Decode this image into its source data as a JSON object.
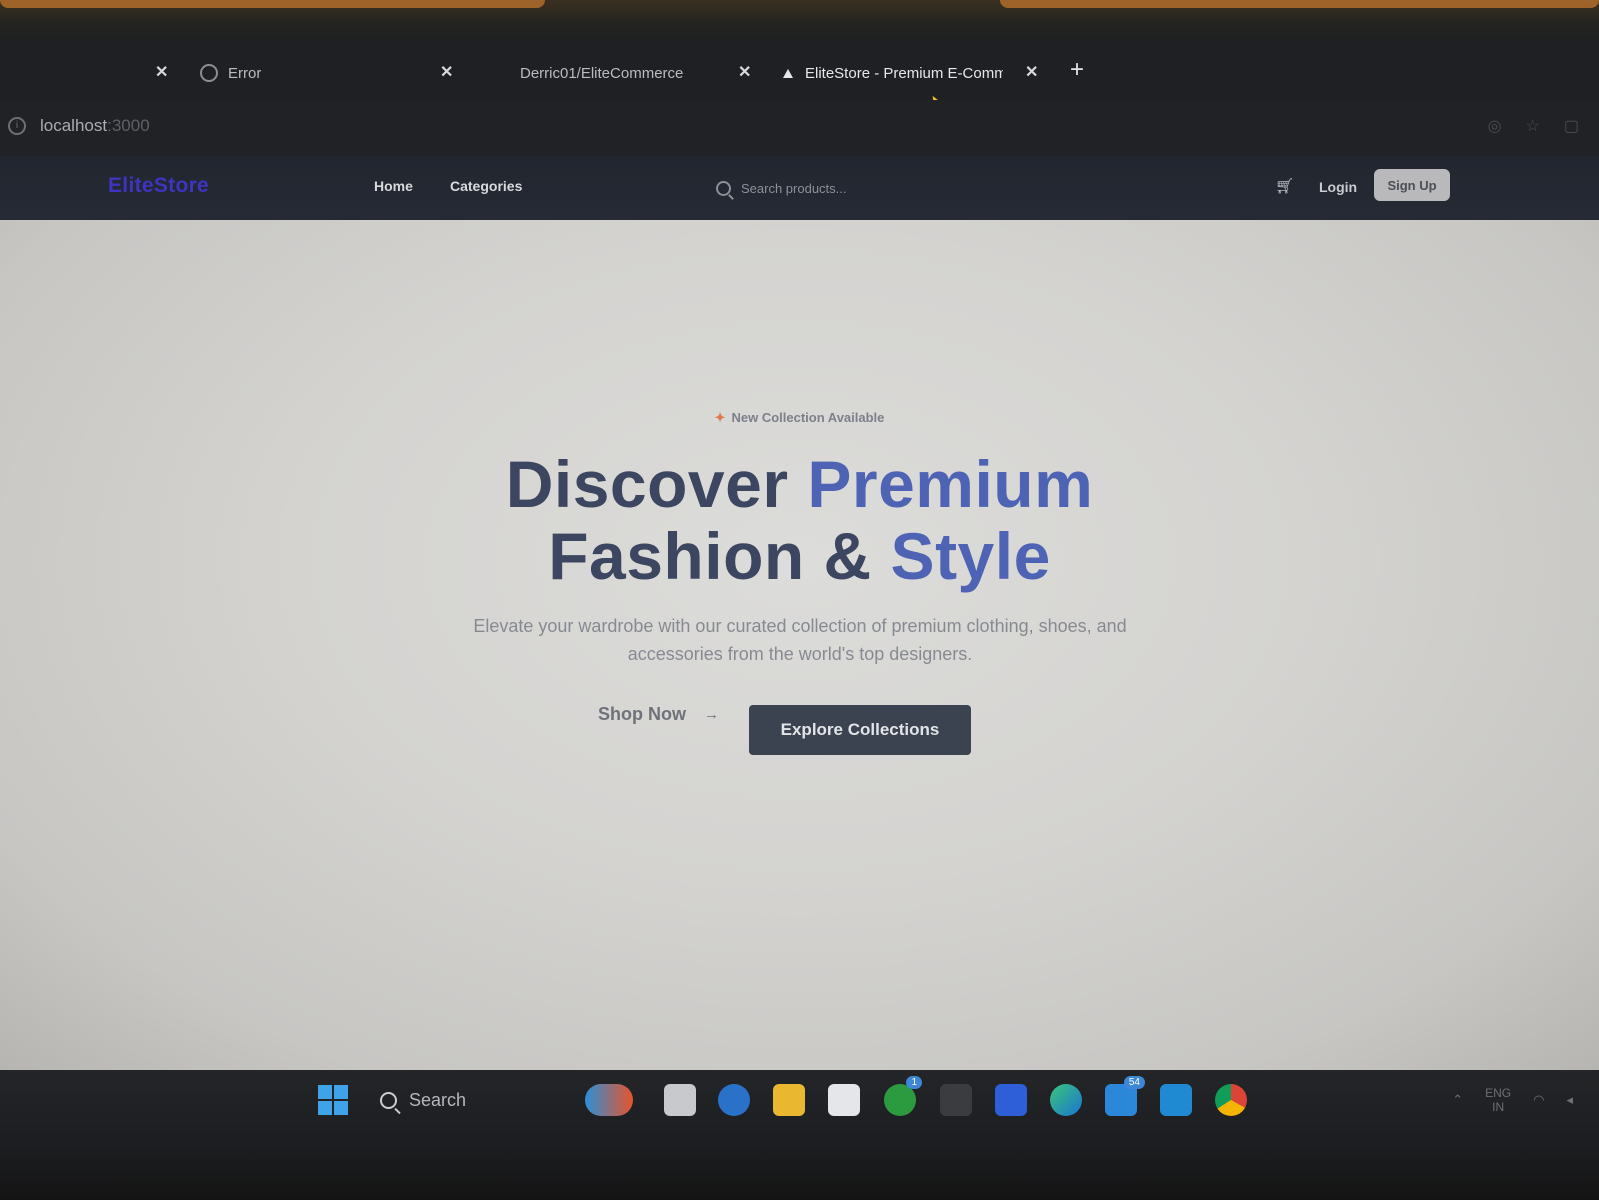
{
  "browser": {
    "tabs": [
      {
        "label": "Error",
        "icon": "globe-icon"
      },
      {
        "label": "Derric01/EliteCommerce",
        "icon": ""
      },
      {
        "label": "EliteStore - Premium E-Comme",
        "icon": "triangle-icon",
        "active": true
      }
    ],
    "new_tab_label": "+",
    "close_label": "✕",
    "url_host": "localhost",
    "url_port": ":3000"
  },
  "site": {
    "logo": "EliteStore",
    "nav": {
      "home": "Home",
      "categories": "Categories"
    },
    "search_placeholder": "Search products...",
    "login": "Login",
    "signup": "Sign Up"
  },
  "hero": {
    "badge": "New Collection Available",
    "headline_part1": "Discover ",
    "headline_accent1": "Premium",
    "headline_part2": "Fashion & ",
    "headline_accent2": "Style",
    "subtext": "Elevate your wardrobe with our curated collection of premium clothing, shoes, and accessories from the world's top designers.",
    "shop_now": "Shop Now",
    "explore": "Explore Collections"
  },
  "taskbar": {
    "search_label": "Search",
    "tray_lang_1": "ENG",
    "tray_lang_2": "IN",
    "badges": {
      "xbox": "1",
      "teams": "54"
    }
  },
  "colors": {
    "logo": "#3e34c0",
    "headline_dark": "#3d4660",
    "headline_accent": "#4f63b4",
    "explore_button": "#3b4350"
  }
}
